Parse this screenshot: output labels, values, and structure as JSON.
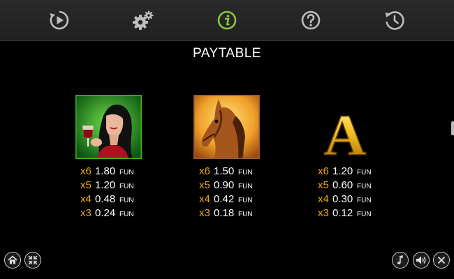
{
  "toolbar": {
    "icons": [
      "replay-icon",
      "settings-icon",
      "info-icon",
      "help-icon",
      "history-icon"
    ],
    "active_color": "#8ec63f",
    "icon_color": "#bdbdbd"
  },
  "title": "PAYTABLE",
  "symbols": [
    {
      "name": "woman-with-wine",
      "border_color": "#3fb618",
      "pays": [
        {
          "mult": "x6",
          "value": "1.80",
          "unit": "FUN"
        },
        {
          "mult": "x5",
          "value": "1.20",
          "unit": "FUN"
        },
        {
          "mult": "x4",
          "value": "0.48",
          "unit": "FUN"
        },
        {
          "mult": "x3",
          "value": "0.24",
          "unit": "FUN"
        }
      ]
    },
    {
      "name": "horse",
      "border_color": "#a0522d",
      "pays": [
        {
          "mult": "x6",
          "value": "1.50",
          "unit": "FUN"
        },
        {
          "mult": "x5",
          "value": "0.90",
          "unit": "FUN"
        },
        {
          "mult": "x4",
          "value": "0.42",
          "unit": "FUN"
        },
        {
          "mult": "x3",
          "value": "0.18",
          "unit": "FUN"
        }
      ]
    },
    {
      "name": "letter-a",
      "label": "A",
      "pays": [
        {
          "mult": "x6",
          "value": "1.20",
          "unit": "FUN"
        },
        {
          "mult": "x5",
          "value": "0.60",
          "unit": "FUN"
        },
        {
          "mult": "x4",
          "value": "0.30",
          "unit": "FUN"
        },
        {
          "mult": "x3",
          "value": "0.12",
          "unit": "FUN"
        }
      ]
    }
  ],
  "bottom_left": [
    "home-icon",
    "fullscreen-icon"
  ],
  "bottom_right": [
    "music-icon",
    "sound-icon",
    "close-icon"
  ]
}
